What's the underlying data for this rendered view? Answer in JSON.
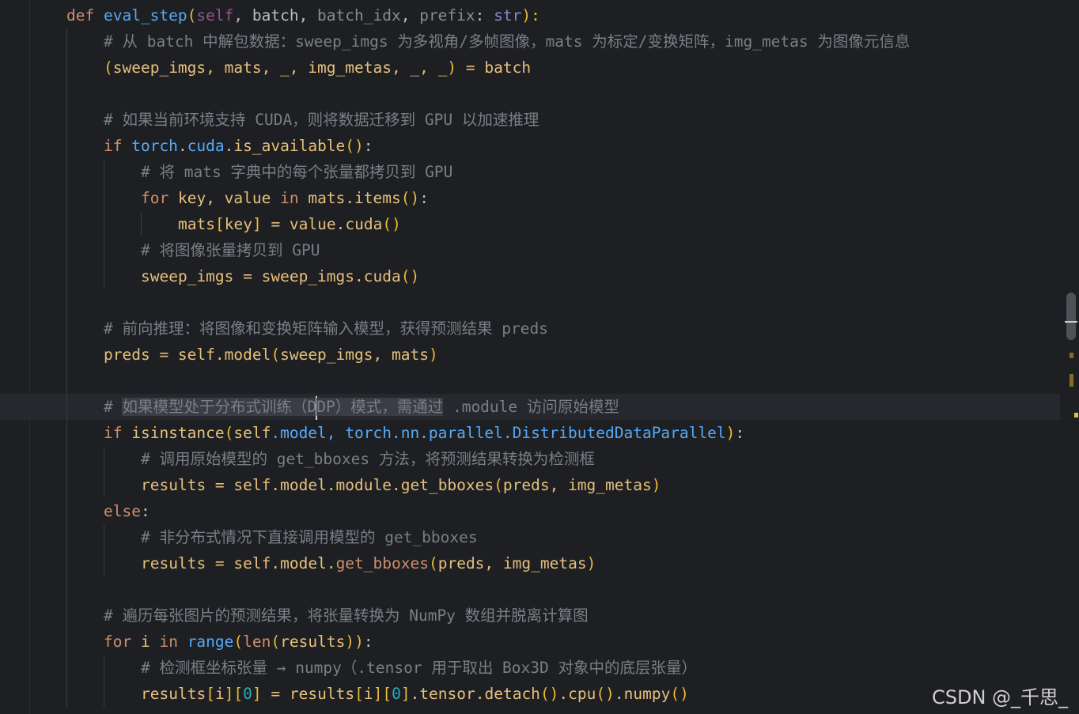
{
  "code_lines": {
    "l01": {
      "kw_def": "def",
      "fn_name": "eval_step",
      "p_open": "(",
      "self": "self",
      "c1": ", ",
      "batch": "batch",
      "c2": ", ",
      "batch_idx": "batch_idx",
      "c3": ", ",
      "prefix": "prefix",
      "colon": ": ",
      "str": "str",
      "end": "):"
    },
    "l02": {
      "comment": "# 从 batch 中解包数据：sweep_imgs 为多视角/多帧图像，mats 为标定/变换矩阵，img_metas 为图像元信息"
    },
    "l03": {
      "open": "(",
      "text": "sweep_imgs, mats, _, img_metas, _, _",
      "close": ")",
      "rest": " = batch"
    },
    "l05": {
      "comment": "# 如果当前环境支持 CUDA，则将数据迁移到 GPU 以加速推理"
    },
    "l06": {
      "kw_if": "if",
      "torch": " torch",
      "dot1": ".",
      "cuda": "cuda",
      "dot2": ".",
      "is_available": "is_available",
      "paren": "()",
      "colon": ":"
    },
    "l07": {
      "comment": "# 将 mats 字典中的每个张量都拷贝到 GPU"
    },
    "l08": {
      "kw_for": "for",
      "vars": " key, value ",
      "kw_in": "in",
      "mats": " mats.items",
      "paren": "()",
      "colon": ":"
    },
    "l09": {
      "mats": "mats",
      "lb": "[",
      "key": "key",
      "rb": "]",
      "mid": " = value.cuda",
      "paren": "()"
    },
    "l10": {
      "comment": "# 将图像张量拷贝到 GPU"
    },
    "l11": {
      "text": "sweep_imgs = sweep_imgs.cuda",
      "paren": "()"
    },
    "l13": {
      "comment": "# 前向推理：将图像和变换矩阵输入模型，获得预测结果 preds"
    },
    "l14": {
      "pre": "preds = ",
      "self": "self",
      "mid": ".model",
      "open": "(",
      "args": "sweep_imgs, mats",
      "close": ")"
    },
    "l16": {
      "hash": "# ",
      "sel_a": "如果模型处于分布式训练（D",
      "sel_b": "DP）模式，需通过",
      "rest": " .module 访问原始模型"
    },
    "l17": {
      "kw_if": "if",
      "isinstance": " isinstance",
      "open": "(",
      "self": "self",
      "model": ".model, torch.nn.parallel.",
      "ddp": "DistributedDataParallel",
      "close": ")",
      "colon": ":"
    },
    "l18": {
      "comment": "# 调用原始模型的 get_bboxes 方法，将预测结果转换为检测框"
    },
    "l19": {
      "pre": "results = ",
      "self": "self",
      "mid": ".model.module.get_bboxes",
      "open": "(",
      "args": "preds, img_metas",
      "close": ")"
    },
    "l20": {
      "kw_else": "else",
      "colon": ":"
    },
    "l21": {
      "comment": "# 非分布式情况下直接调用模型的 get_bboxes"
    },
    "l22": {
      "pre": "results = ",
      "self": "self",
      "mid": ".model.",
      "get_bboxes": "get_bboxes",
      "open": "(",
      "args": "preds, img_metas",
      "close": ")"
    },
    "l24": {
      "comment": "# 遍历每张图片的预测结果，将张量转换为 NumPy 数组并脱离计算图"
    },
    "l25": {
      "kw_for": "for",
      "i": " i ",
      "kw_in": "in",
      "range": " range",
      "open": "(",
      "len": "len",
      "open2": "(",
      "results": "results",
      "close": "))",
      "colon": ":"
    },
    "l26": {
      "comment": "# 检测框坐标张量 → numpy（.tensor 用于取出 Box3D 对象中的底层张量）"
    },
    "l27": {
      "a": "results",
      "b1": "[",
      "i1": "i",
      "b2": "][",
      "z1": "0",
      "b3": "]",
      "eq": " = results",
      "b4": "[",
      "i2": "i",
      "b5": "][",
      "z2": "0",
      "b6": "]",
      "rest": ".tensor.detach",
      "p1": "()",
      "cpu": ".cpu",
      "p2": "()",
      "numpy": ".numpy",
      "p3": "()"
    }
  },
  "watermark": "CSDN @_千思_",
  "colors": {
    "background": "#1e1f22",
    "keyword": "#cf8e6d",
    "function": "#56a8f5",
    "self": "#94558d",
    "comment": "#7a7e85",
    "bracket": "#e8ba36",
    "builtin": "#8888c6",
    "number": "#2aacb8"
  }
}
